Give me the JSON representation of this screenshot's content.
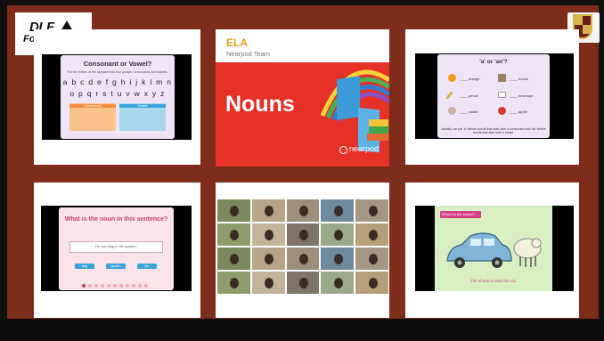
{
  "brand": {
    "logo_dlf": "DLF",
    "logo_foundation": "Foundation"
  },
  "slide_consonant": {
    "title": "Consonant or Vowel?",
    "subtitle": "Put the letters of the alphabet into two groups: consonants and vowels.",
    "letters_row1": "a b c d e f g h i j k l m n",
    "letters_row2": "o p q r s t u v w x y z",
    "group_consonants": "Consonants",
    "group_vowels": "Vowels"
  },
  "slide_ela": {
    "title": "ELA",
    "team": "Nearpod Team",
    "headline": "Nouns",
    "logo_text": "nearpod"
  },
  "slide_articles": {
    "title": "'a' or 'an'?",
    "items": [
      {
        "blank": "____",
        "word": "orange"
      },
      {
        "blank": "____",
        "word": "house"
      },
      {
        "blank": "____",
        "word": "pencil"
      },
      {
        "blank": "____",
        "word": "envelope"
      },
      {
        "blank": "____",
        "word": "rabbit"
      },
      {
        "blank": "____",
        "word": "apple"
      }
    ],
    "footer": "Usually, we put 'a' before words that start with a consonant and 'an' before words that start with a vowel."
  },
  "slide_noun": {
    "question": "What is the noun in this sentence?",
    "sentence": "He can sing in the garden.",
    "options": [
      "sing",
      "garden",
      "the"
    ],
    "progress_dots": 11,
    "progress_active": 1
  },
  "slide_sheep": {
    "prompt": "Where is the sheep?",
    "sentence": "The sheep is near the car."
  },
  "colors": {
    "frame": "#7e2d1a",
    "nearpod_red": "#e63127",
    "ela_gold": "#e29e1a",
    "noun_pink": "#c24069",
    "sheep_magenta": "#d9408a"
  }
}
